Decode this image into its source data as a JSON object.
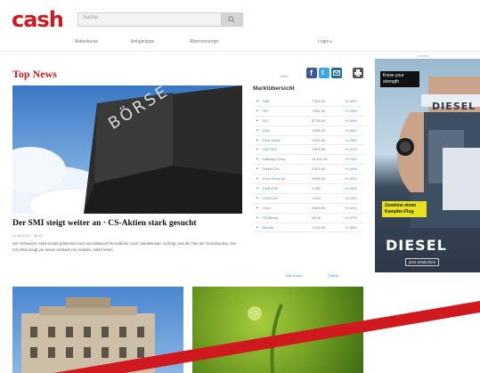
{
  "header": {
    "logo": "cash",
    "search_placeholder": "Suche",
    "nav": [
      "Aktienkurse",
      "Anlagetipps",
      "Altersvorsorge",
      "Login"
    ]
  },
  "top_news": {
    "title": "Top News",
    "share_label": "Teilen",
    "image_text": "BÖRSE",
    "headline": "Der SMI steigt weiter an · CS-Aktien stark gesucht",
    "date": "21.09.2013 · 08:15",
    "teaser": "Der Schweizer Aktienmarkt präsentiert sich am Mittwoch freundlicher nach Handelsstart. Gefragt sind die Titel der Grossbanken. Die CS-Aktie steigt vor einem Verkauf von Anteilen. Mehr lesen"
  },
  "market": {
    "title": "Marktübersicht",
    "rows": [
      {
        "name": "SMI",
        "value": "7'900.00",
        "change": "+0.40%"
      },
      {
        "name": "SPI",
        "value": "7'551.00",
        "change": "+0.36%"
      },
      {
        "name": "SLI",
        "value": "8'739.00",
        "change": "+0.35%"
      },
      {
        "name": "DAX",
        "value": "1'598.00",
        "change": "+0.38%"
      },
      {
        "name": "Dow Jones",
        "value": "1'491.00",
        "change": "+0.29%"
      },
      {
        "name": "S&P 500",
        "value": "1'509.00",
        "change": "+0.31%"
      },
      {
        "name": "Nasdaq Comp.",
        "value": "14'451.00",
        "change": "+0.24%"
      },
      {
        "name": "Nikkei 225",
        "value": "4'322.00",
        "change": "+0.40%"
      },
      {
        "name": "Euro Stoxx 50",
        "value": "4'548.00",
        "change": "+0.33%"
      },
      {
        "name": "EUR/CHF",
        "value": "1.092",
        "change": "+0.06%"
      },
      {
        "name": "USD/CHF",
        "value": "1.004",
        "change": "+0.04%"
      },
      {
        "name": "Gold",
        "value": "4'855.00",
        "change": "+0.42%"
      },
      {
        "name": "Öl (Brent)",
        "value": "48.46",
        "change": "+0.47%"
      },
      {
        "name": "Bitcoin",
        "value": "1'113.00",
        "change": "+0.38%"
      }
    ],
    "link_more": "Alle Kurse",
    "link_charts": "Charts"
  },
  "ad": {
    "label": "Anzeige",
    "top_text": "Know your strength",
    "brand": "DIESEL",
    "tag_text": "Gewinne einen Kampfer-Flug",
    "cta": "jetzt entdecken"
  },
  "colors": {
    "brand_red": "#d0191f",
    "link_blue": "#4a8ac0",
    "facebook": "#3b5998",
    "twitter": "#3aa6e6",
    "xing": "#1a6d9d",
    "print": "#555555"
  },
  "icons": [
    "search-icon",
    "facebook-icon",
    "twitter-icon",
    "email-icon",
    "print-icon",
    "chevron-down-icon"
  ]
}
